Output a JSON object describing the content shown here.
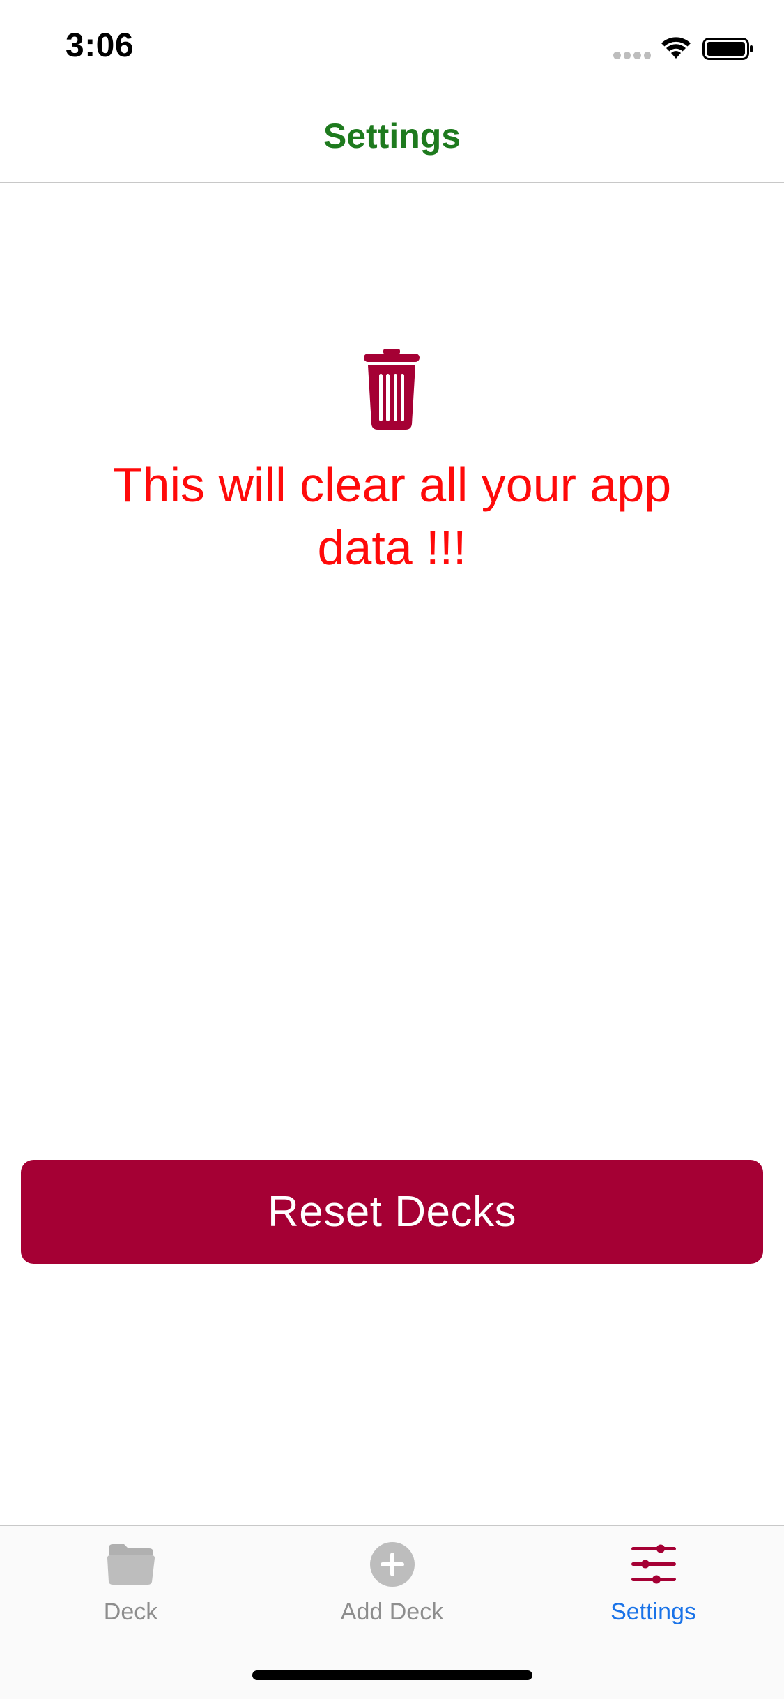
{
  "status_bar": {
    "time": "3:06",
    "icons": [
      "cellular-signal-icon",
      "wifi-icon",
      "battery-icon"
    ]
  },
  "nav": {
    "title": "Settings"
  },
  "content": {
    "icon": "trash-icon",
    "warning": "This will clear all your app data !!!",
    "reset_button_label": "Reset Decks"
  },
  "tab_bar": {
    "tabs": [
      {
        "label": "Deck",
        "icon": "folder-icon",
        "active": false
      },
      {
        "label": "Add Deck",
        "icon": "plus-circle-icon",
        "active": false
      },
      {
        "label": "Settings",
        "icon": "sliders-icon",
        "active": true
      }
    ]
  },
  "colors": {
    "nav_title": "#1e7a1e",
    "warning_text": "#ff0a0a",
    "accent": "#a50034",
    "tab_active_label": "#1a73e8",
    "tab_inactive": "#8e8e8e"
  }
}
